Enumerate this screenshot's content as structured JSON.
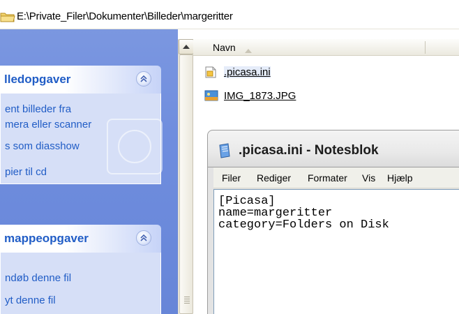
{
  "address_bar": {
    "path": "E:\\Private_Filer\\Dokumenter\\Billeder\\margeritter"
  },
  "task_pane": {
    "picture_tasks": {
      "title": "lledopgaver",
      "items": [
        "ent billeder fra",
        "mera eller scanner",
        "s som diasshow",
        "pier til cd"
      ]
    },
    "folder_tasks": {
      "title": "mappeopgaver",
      "items": [
        "ndøb denne fil",
        "yt denne fil"
      ]
    }
  },
  "file_list": {
    "column_name": "Navn",
    "files": [
      {
        "name": ".picasa.ini",
        "icon": "ini-file-icon"
      },
      {
        "name": "IMG_1873.JPG",
        "icon": "jpg-image-icon"
      }
    ]
  },
  "notepad": {
    "title": ".picasa.ini - Notesblok",
    "menu": [
      "Filer",
      "Rediger",
      "Formater",
      "Vis",
      "Hjælp"
    ],
    "content_lines": [
      "[Picasa]",
      "name=margeritter",
      "category=Folders on Disk"
    ]
  },
  "colors": {
    "task_pane_bg": "#6f8dde",
    "task_header_text": "#215dc6",
    "task_body_bg": "#d6dff7"
  }
}
